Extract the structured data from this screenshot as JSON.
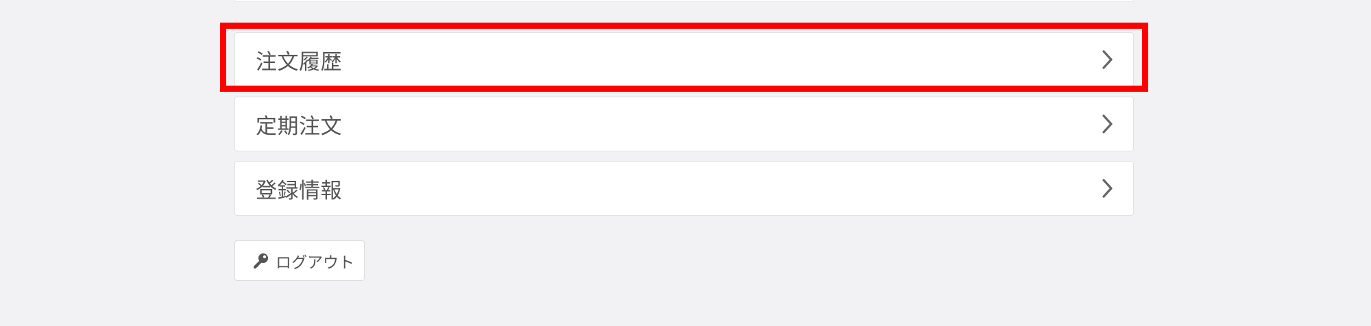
{
  "menu": {
    "items": [
      {
        "label": "注文履歴",
        "icon": "chevron-right-icon"
      },
      {
        "label": "定期注文",
        "icon": "chevron-right-icon"
      },
      {
        "label": "登録情報",
        "icon": "chevron-right-icon"
      }
    ]
  },
  "logout": {
    "label": "ログアウト",
    "icon": "key-icon"
  },
  "colors": {
    "background": "#f2f2f4",
    "card": "#ffffff",
    "text": "#555555",
    "highlight": "#ff0000"
  }
}
